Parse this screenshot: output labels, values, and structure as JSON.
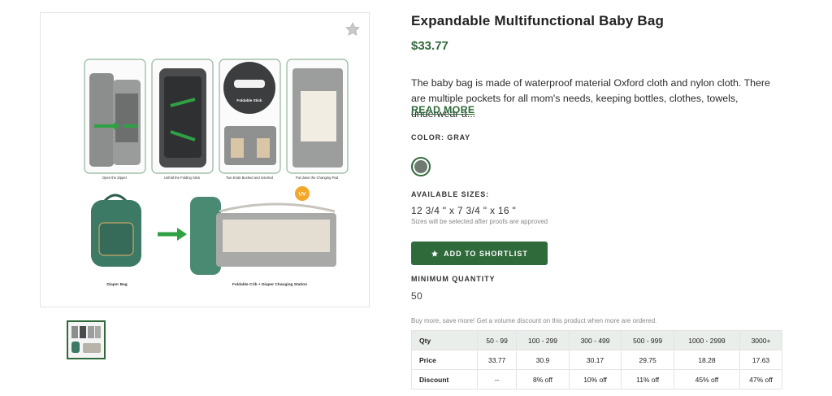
{
  "product": {
    "title": "Expandable Multifunctional Baby Bag",
    "price": "$33.77",
    "description": "The baby bag is made of waterproof material Oxford cloth and nylon cloth. There are multiple pockets for all mom's needs, keeping bottles, clothes, towels, underwear a...",
    "read_more": "READ MORE"
  },
  "gallery": {
    "favorite_icon": "star-icon",
    "panel_captions": [
      "Open the Zipper",
      "Unfold the Folding Stick",
      "Two Ends Bucked and Inserted",
      "Put down the Changing Pad"
    ],
    "callout_label": "Foldable Stick",
    "uv_badge": "UV",
    "bottom_captions": [
      "Diaper Bag",
      "Foldable Crib + Diaper Changing Station"
    ]
  },
  "color": {
    "label": "COLOR: GRAY",
    "swatch_hex": "#6f7a70"
  },
  "sizes": {
    "label": "AVAILABLE SIZES:",
    "value": "12 3/4 \" x 7 3/4 \" x 16 \"",
    "note": "Sizes will be selected after proofs are approved"
  },
  "shortlist": {
    "label": "ADD TO SHORTLIST",
    "icon": "star-icon"
  },
  "minimum_quantity": {
    "label": "MINIMUM QUANTITY",
    "value": "50"
  },
  "volume": {
    "note": "Buy more, save more! Get a volume discount on this product when more are ordered.",
    "headers": [
      "Qty",
      "50 - 99",
      "100 - 299",
      "300 - 499",
      "500 - 999",
      "1000 - 2999",
      "3000+"
    ],
    "rows": [
      [
        "Price",
        "33.77",
        "30.9",
        "30.17",
        "29.75",
        "18.28",
        "17.63"
      ],
      [
        "Discount",
        "--",
        "8% off",
        "10% off",
        "11% off",
        "45% off",
        "47% off"
      ]
    ]
  },
  "colors": {
    "accent": "#2f6a3b",
    "bag_gray": "#7d7f7f",
    "bag_green": "#3d7a65",
    "table_header_bg": "#e9eeea"
  }
}
